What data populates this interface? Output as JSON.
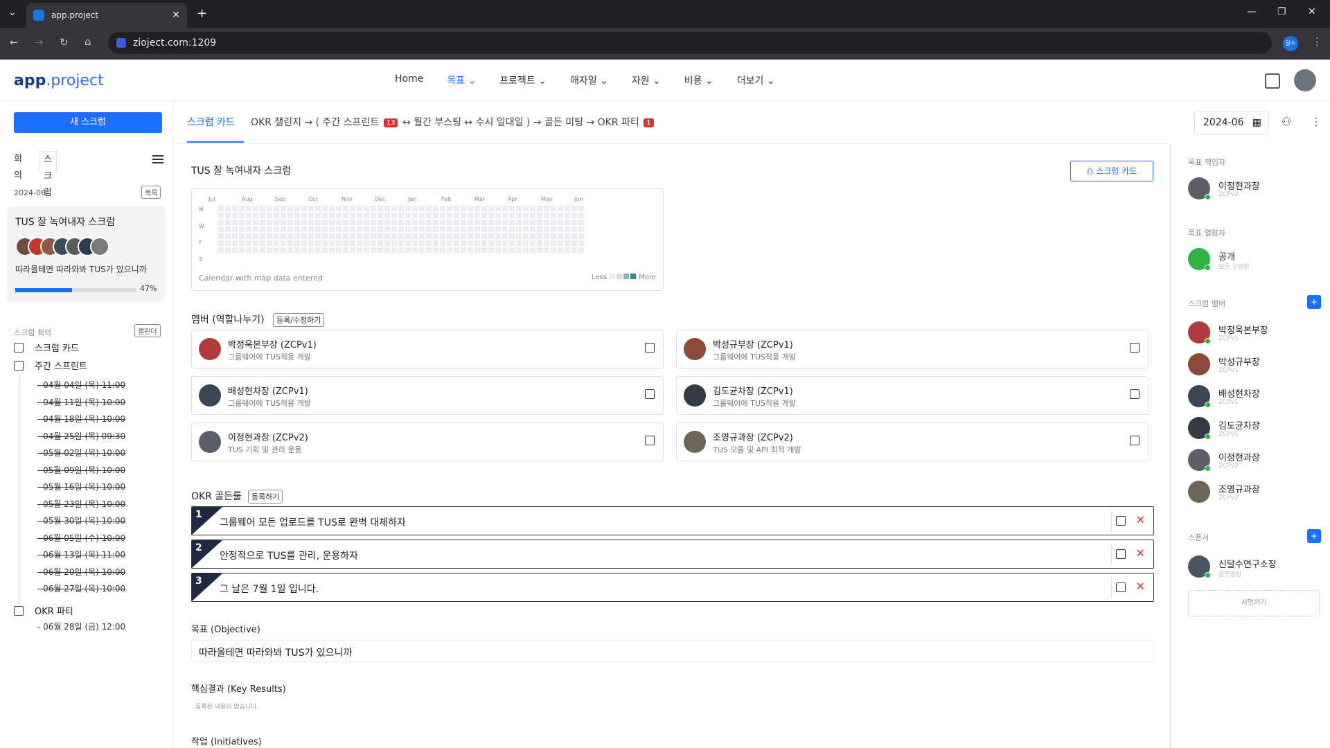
{
  "browser": {
    "tab_title": "app.project",
    "url": "zioject.com:1209",
    "profile_label": "달수"
  },
  "app": {
    "logo_bold": "app",
    "logo_rest": ".project",
    "nav": [
      "Home",
      "목표",
      "프로젝트",
      "애자일",
      "자원",
      "비용",
      "더보기"
    ],
    "nav_active": "목표"
  },
  "sidebar": {
    "new_button": "새 스크럼",
    "tabs": [
      "회의",
      "스크럼"
    ],
    "month": "2024-06",
    "list_button": "목록",
    "card": {
      "title": "TUS 잘 녹여내자 스크럼",
      "objective": "따라올테면 따라와봐 TUS가 있으니까",
      "progress_label": "47%",
      "progress": 47
    },
    "meeting_header": "스크럼 회의",
    "calendar_button": "캘린더",
    "scrum_card_label": "스크럼 카드",
    "weekly_label": "주간 스프린트",
    "weekly_dates": [
      "- 04월 04일 (목) 11:00",
      "- 04월 11일 (목) 10:00",
      "- 04월 18일 (목) 10:00",
      "- 04월 25일 (목) 09:30",
      "- 05월 02일 (목) 10:00",
      "- 05월 09일 (목) 10:00",
      "- 05월 16일 (목) 10:00",
      "- 05월 23일 (목) 10:00",
      "- 05월 30일 (목) 10:00",
      "- 06월 05일 (수) 10:00",
      "- 06월 13일 (목) 11:00",
      "- 06월 20일 (목) 10:00",
      "- 06월 27일 (목) 10:00"
    ],
    "okr_party_label": "OKR 파티",
    "okr_party_date": "- 06월 28일 (금) 12:00"
  },
  "tabs_bar": {
    "active": "스크럼 카드",
    "flow_1": "OKR 챌린지 → ( 주간 스프린트",
    "badge_1": "13",
    "flow_2": "↔ 월간 부스팅 ↔ 수시 일대일 ) → 골든 미팅 → OKR 파티",
    "badge_2": "1",
    "date": "2024-06"
  },
  "content": {
    "title": "TUS 잘 녹여내자 스크럼",
    "print_button": "스크럼 카드",
    "heatmap": {
      "months": [
        "Jul",
        "Aug",
        "Sep",
        "Oct",
        "Nov",
        "Dec",
        "Jan",
        "Feb",
        "Mar",
        "Apr",
        "May",
        "Jun"
      ],
      "days": [
        "M",
        "W",
        "F",
        "S"
      ],
      "caption": "Calendar with map data entered",
      "less": "Less",
      "more": "More",
      "scale_colors": [
        "#ebedf0",
        "#cfe5e2",
        "#7fbfb5",
        "#2f8f83"
      ]
    },
    "members_title": "멤버 (역할나누기)",
    "members_button": "등록/수정하기",
    "members": [
      {
        "name": "박정욱본부장 (ZCPv1)",
        "role": "그룹웨어에 TUS적용 개발"
      },
      {
        "name": "박성규부장 (ZCPv1)",
        "role": "그룹웨어에 TUS적용 개발"
      },
      {
        "name": "배성현차장 (ZCPv1)",
        "role": "그룹웨어에 TUS적용 개발"
      },
      {
        "name": "김도균차장 (ZCPv1)",
        "role": "그룹웨어에 TUS적용 개발"
      },
      {
        "name": "이정현과장 (ZCPv2)",
        "role": "TUS 기획 및 관리 운용"
      },
      {
        "name": "조영규과장 (ZCPv2)",
        "role": "TUS 모듈 및 API 최적 개발"
      }
    ],
    "golden_title": "OKR 골든룰",
    "golden_button": "등록하기",
    "golden_rules": [
      {
        "n": "1",
        "text": "그룹웨어 모든 업로드를 TUS로 완벽 대체하자"
      },
      {
        "n": "2",
        "text": "안정적으로 TUS를 관리, 운용하자"
      },
      {
        "n": "3",
        "text": "그 날은 7월 1일 입니다."
      }
    ],
    "objective_title": "목표 (Objective)",
    "objective_value": "따라올테면 따라와봐 TUS가 있으니까",
    "kr_title": "핵심결과 (Key Results)",
    "kr_empty": "등록된 내용이 없습니다.",
    "initiatives_title": "작업 (Initiatives)"
  },
  "right_panel": {
    "owner_header": "목표 책임자",
    "owner": {
      "name": "이정현과장",
      "sub": "ZCPv2"
    },
    "viewer_header": "목표 열람자",
    "viewer": {
      "name": "공개",
      "sub": "모든 구성원"
    },
    "members_header": "스크럼 멤버",
    "members": [
      {
        "name": "박정욱본부장",
        "sub": "ZCPv1"
      },
      {
        "name": "박성규부장",
        "sub": "ZCPv1"
      },
      {
        "name": "배성현차장",
        "sub": "ZCPv1"
      },
      {
        "name": "김도균차장",
        "sub": "ZCPv1"
      },
      {
        "name": "이정현과장",
        "sub": "ZCPv2"
      },
      {
        "name": "조영규과장",
        "sub": "ZCPv2"
      }
    ],
    "signer_header": "스폰서",
    "signer": {
      "name": "신달수연구소장",
      "sub": "플랫폼팀"
    },
    "sign_button": "서명하기"
  }
}
